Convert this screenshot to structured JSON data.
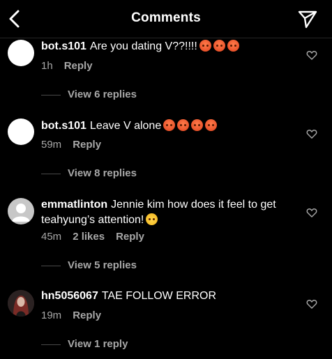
{
  "header": {
    "title": "Comments"
  },
  "comments": [
    {
      "username": "bot.s101",
      "text": "Are you dating V??!!!!",
      "emojis": [
        "angry",
        "angry",
        "angry"
      ],
      "time": "1h",
      "likes": "",
      "reply_label": "Reply",
      "replies_label": "View 6 replies",
      "avatar": "white"
    },
    {
      "username": "bot.s101",
      "text": "Leave V alone",
      "emojis": [
        "angry",
        "angry",
        "angry",
        "angry"
      ],
      "time": "59m",
      "likes": "",
      "reply_label": "Reply",
      "replies_label": "View 8 replies",
      "avatar": "white"
    },
    {
      "username": "emmatlinton",
      "text": "Jennie kim how does it feel to get teahyung’s attention!",
      "emojis": [
        "upside-down"
      ],
      "time": "45m",
      "likes": "2 likes",
      "reply_label": "Reply",
      "replies_label": "View 5 replies",
      "avatar": "default"
    },
    {
      "username": "hn5056067",
      "text": "TAE FOLLOW ERROR",
      "emojis": [],
      "time": "19m",
      "likes": "",
      "reply_label": "Reply",
      "replies_label": "View 1 reply",
      "avatar": "photo"
    }
  ]
}
